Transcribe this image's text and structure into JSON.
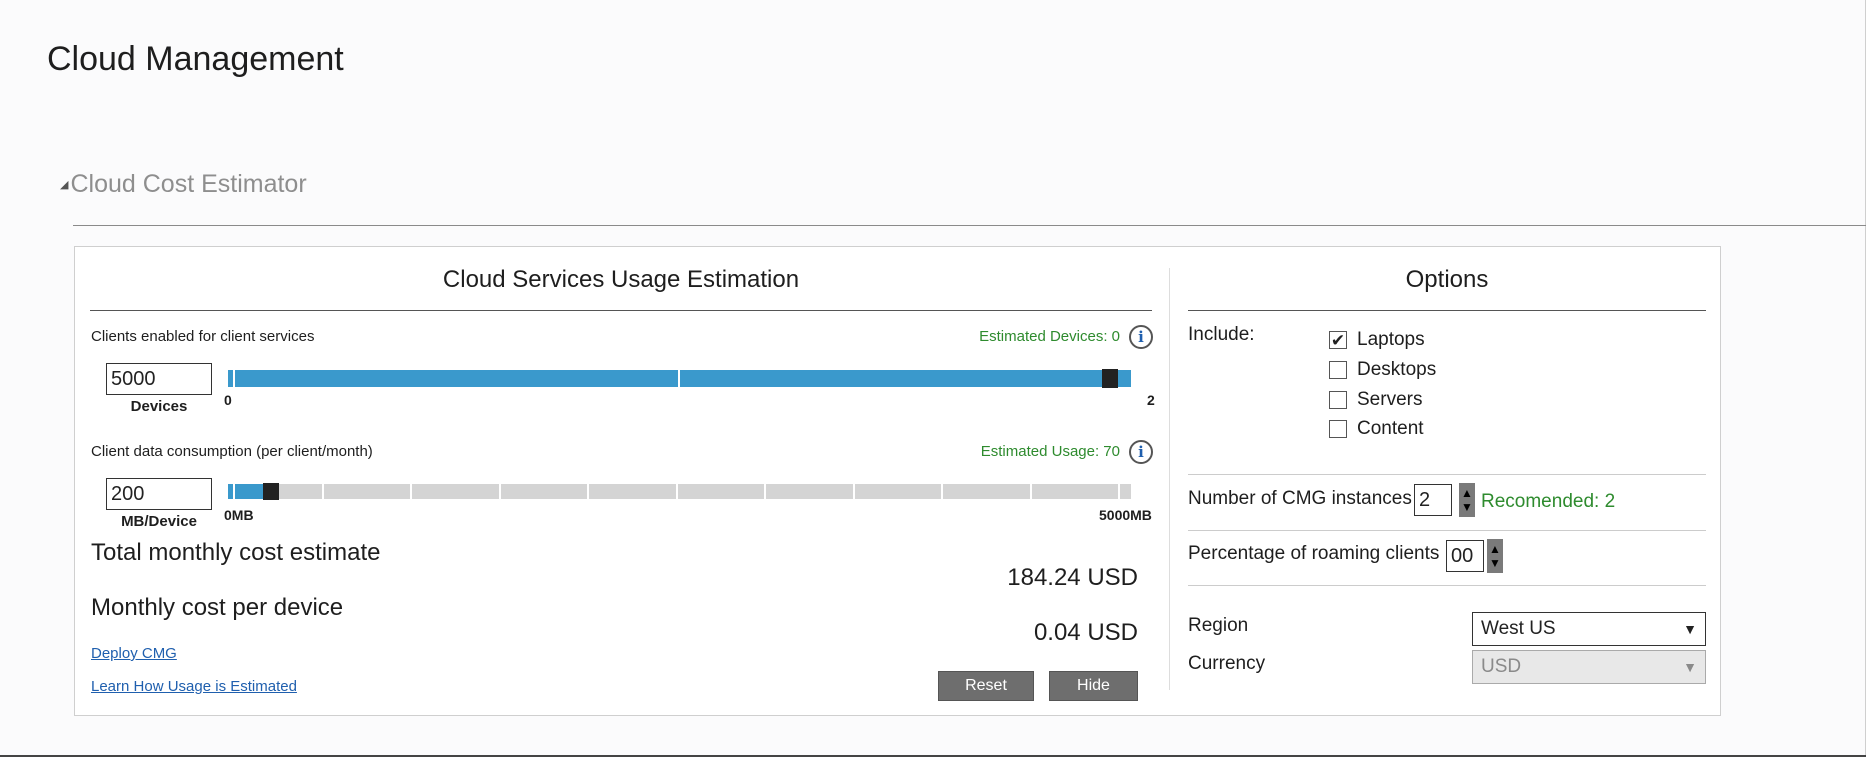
{
  "page": {
    "title": "Cloud Management"
  },
  "section": {
    "title": "Cloud Cost Estimator"
  },
  "usage": {
    "title": "Cloud Services Usage Estimation",
    "clients": {
      "label": "Clients enabled for client services",
      "estimate": "Estimated Devices: 0",
      "value": "5000",
      "unit": "Devices",
      "min_label": "0",
      "max_label": "2",
      "slider_fraction": 0.985
    },
    "data": {
      "label": "Client data consumption (per client/month)",
      "estimate": "Estimated Usage: 70",
      "value": "200",
      "unit": "MB/Device",
      "min_label": "0MB",
      "max_label": "5000MB",
      "slider_fraction": 0.04
    },
    "total_label": "Total monthly cost estimate",
    "total_value": "184.24 USD",
    "per_device_label": "Monthly cost per device",
    "per_device_value": "0.04 USD",
    "deploy_link": "Deploy CMG",
    "learn_link": "Learn How Usage is Estimated",
    "reset_label": "Reset",
    "hide_label": "Hide"
  },
  "options": {
    "title": "Options",
    "include_label": "Include:",
    "checkboxes": [
      {
        "label": "Laptops",
        "checked": true
      },
      {
        "label": "Desktops",
        "checked": false
      },
      {
        "label": "Servers",
        "checked": false
      },
      {
        "label": "Content",
        "checked": false
      }
    ],
    "cmg_label": "Number of CMG instances",
    "cmg_value": "2",
    "cmg_recommended": "Recomended: 2",
    "roaming_label": "Percentage of roaming clients",
    "roaming_value": "00",
    "region_label": "Region",
    "region_value": "West US",
    "currency_label": "Currency",
    "currency_value": "USD"
  },
  "icons": {
    "info": "info-icon",
    "collapse": "collapse-triangle-icon",
    "check": "checkmark-icon",
    "chevron": "chevron-down-icon"
  },
  "colors": {
    "accent_blue": "#3a99cc",
    "green_estimate": "#2e8b2e",
    "link_blue": "#1f5fae"
  }
}
